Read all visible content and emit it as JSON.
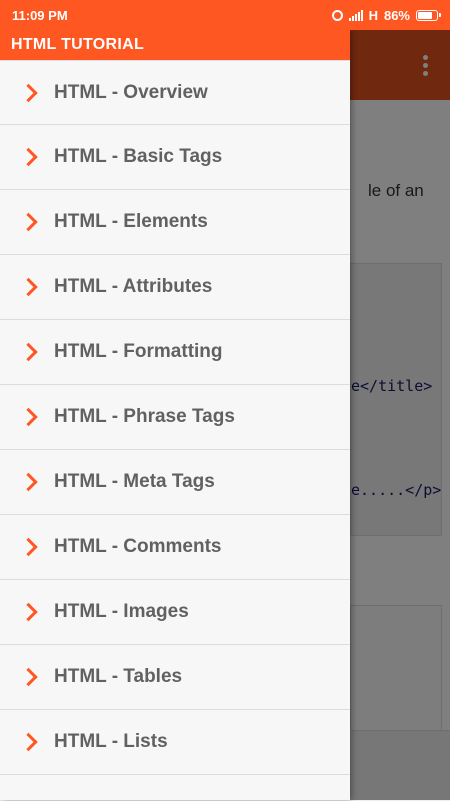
{
  "status_bar": {
    "time": "11:09 PM",
    "network": "H",
    "battery": "86%",
    "battery_level": 0.86
  },
  "drawer": {
    "title": "HTML TUTORIAL",
    "items": [
      {
        "label": "HTML - Overview",
        "icon": "chevron-right-icon"
      },
      {
        "label": "HTML - Basic Tags",
        "icon": "chevron-right-icon"
      },
      {
        "label": "HTML - Elements",
        "icon": "chevron-right-icon"
      },
      {
        "label": "HTML - Attributes",
        "icon": "chevron-right-icon"
      },
      {
        "label": "HTML - Formatting",
        "icon": "chevron-right-icon"
      },
      {
        "label": "HTML - Phrase Tags",
        "icon": "chevron-right-icon"
      },
      {
        "label": "HTML - Meta Tags",
        "icon": "chevron-right-icon"
      },
      {
        "label": "HTML - Comments",
        "icon": "chevron-right-icon"
      },
      {
        "label": "HTML - Images",
        "icon": "chevron-right-icon"
      },
      {
        "label": "HTML - Tables",
        "icon": "chevron-right-icon"
      },
      {
        "label": "HTML - Lists",
        "icon": "chevron-right-icon"
      }
    ]
  },
  "background": {
    "text_fragment": "le of an",
    "code_line_1": "e</title>",
    "code_line_2": "e.....</p>"
  },
  "colors": {
    "accent": "#ff5722",
    "toolbar_dim": "#e0501f",
    "item_text": "#616161"
  }
}
